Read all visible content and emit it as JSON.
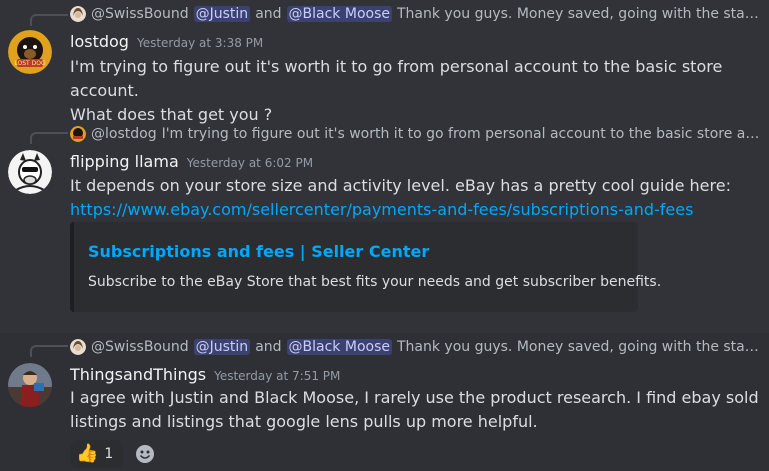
{
  "messages": [
    {
      "reply": {
        "author": "@SwissBound",
        "mention1": "@Justin",
        "and": "and",
        "mention2": "@Black Moose",
        "text": "Thank you guys. Money saved, going with the starter s..."
      },
      "author": "lostdog",
      "avatar_badge": "LOST DOG",
      "timestamp": "Yesterday at 3:38 PM",
      "lines": [
        "I'm trying to figure out it's worth it to go from personal account to the basic store account.",
        "What does that get you ?"
      ]
    },
    {
      "reply": {
        "author": "@lostdog",
        "text": "I'm trying to figure out it's worth it to go from personal account to the basic store accoun..."
      },
      "author": "flipping llama",
      "timestamp": "Yesterday at 6:02 PM",
      "lines": [
        "It depends on your store size and activity level. eBay has a pretty cool guide here:"
      ],
      "link": "https://www.ebay.com/sellercenter/payments-and-fees/subscriptions-and-fees",
      "embed": {
        "title": "Subscriptions and fees | Seller Center",
        "description": "Subscribe to the eBay Store that best fits your needs and get subscriber benefits."
      }
    },
    {
      "reply": {
        "author": "@SwissBound",
        "mention1": "@Justin",
        "and": "and",
        "mention2": "@Black Moose",
        "text": "Thank you guys. Money saved, going with the starter s..."
      },
      "author": "ThingsandThings",
      "timestamp": "Yesterday at 7:51 PM",
      "lines": [
        "I agree with Justin and Black Moose, I rarely use the  product research.  I find ebay sold",
        "listings and listings that google lens pulls up more helpful."
      ],
      "reaction": {
        "emoji": "👍",
        "count": "1"
      }
    }
  ],
  "colors": {
    "background": "#313338",
    "hover_background": "#2e3035",
    "link": "#00a8fc",
    "mention_bg": "#3c4270",
    "mention_text": "#c9cdfb"
  },
  "icons": {
    "add_reaction": "smiley-add-icon"
  }
}
